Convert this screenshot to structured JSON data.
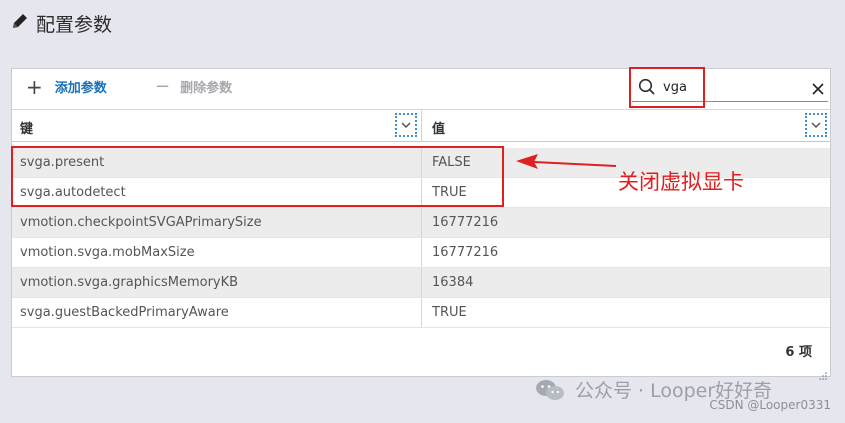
{
  "page": {
    "title": "配置参数"
  },
  "toolbar": {
    "add_label": "添加参数",
    "delete_label": "删除参数"
  },
  "search": {
    "value": "vga"
  },
  "table": {
    "columns": [
      "键",
      "值"
    ],
    "rows": [
      {
        "key": "svga.present",
        "value": "FALSE"
      },
      {
        "key": "svga.autodetect",
        "value": "TRUE"
      },
      {
        "key": "vmotion.checkpointSVGAPrimarySize",
        "value": "16777216"
      },
      {
        "key": "vmotion.svga.mobMaxSize",
        "value": "16777216"
      },
      {
        "key": "vmotion.svga.graphicsMemoryKB",
        "value": "16384"
      },
      {
        "key": "svga.guestBackedPrimaryAware",
        "value": "TRUE"
      }
    ],
    "count_label": "6 项"
  },
  "annotation": {
    "text": "关闭虚拟显卡"
  },
  "watermark": {
    "text": "公众号 · Looper好好奇",
    "csdn": "CSDN @Looper0331"
  },
  "colors": {
    "accent": "#1a72b8",
    "highlight": "#e02020",
    "disabled": "#a6a8ad"
  },
  "icons": [
    "pencil-icon",
    "plus-icon",
    "minus-icon",
    "search-icon",
    "close-icon",
    "chevron-down-icon",
    "wechat-icon"
  ]
}
